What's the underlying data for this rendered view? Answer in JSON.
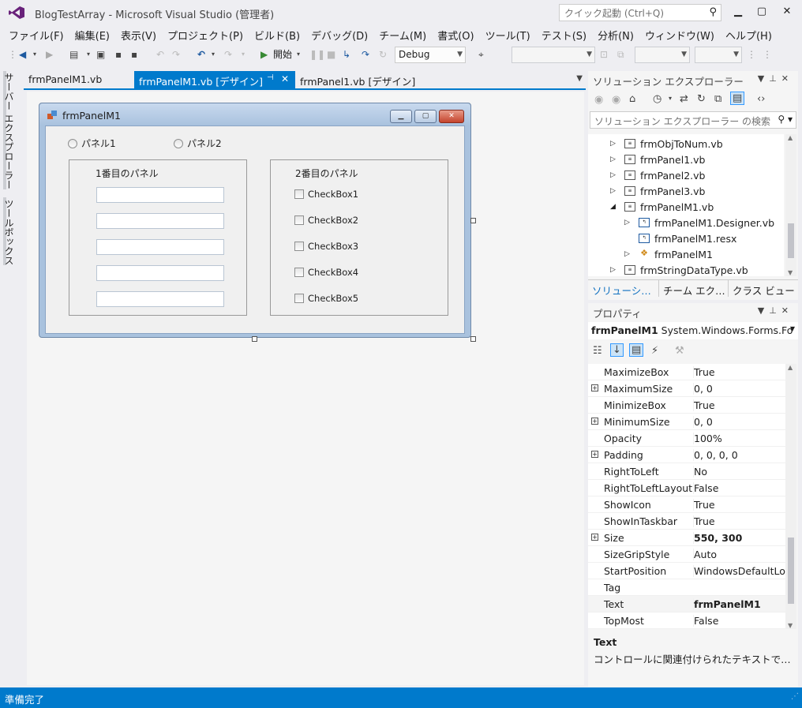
{
  "window": {
    "title": "BlogTestArray - Microsoft Visual Studio (管理者)",
    "quick_launch_placeholder": "クイック起動 (Ctrl+Q)"
  },
  "menu": [
    "ファイル(F)",
    "編集(E)",
    "表示(V)",
    "プロジェクト(P)",
    "ビルド(B)",
    "デバッグ(D)",
    "チーム(M)",
    "書式(O)",
    "ツール(T)",
    "テスト(S)",
    "分析(N)",
    "ウィンドウ(W)",
    "ヘルプ(H)"
  ],
  "toolbar": {
    "start_label": "開始",
    "config_value": "Debug"
  },
  "left_strip": {
    "server_explorer": "サーバー エクスプローラー",
    "toolbox": "ツールボックス"
  },
  "doc_tabs": [
    {
      "label": "frmPanelM1.vb",
      "active": false
    },
    {
      "label": "frmPanelM1.vb [デザイン]",
      "active": true
    },
    {
      "label": "frmPanel1.vb [デザイン]",
      "active": false
    }
  ],
  "form": {
    "title": "frmPanelM1",
    "radio1": "パネル1",
    "radio2": "パネル2",
    "group1_title": "1番目のパネル",
    "group2_title": "2番目のパネル",
    "checkboxes": [
      "CheckBox1",
      "CheckBox2",
      "CheckBox3",
      "CheckBox4",
      "CheckBox5"
    ]
  },
  "solution_explorer": {
    "header": "ソリューション エクスプローラー",
    "search_placeholder": "ソリューション エクスプローラー の検索",
    "tree": [
      {
        "label": "frmObjToNum.vb",
        "depth": 0,
        "arrow": "▷"
      },
      {
        "label": "frmPanel1.vb",
        "depth": 0,
        "arrow": "▷"
      },
      {
        "label": "frmPanel2.vb",
        "depth": 0,
        "arrow": "▷"
      },
      {
        "label": "frmPanel3.vb",
        "depth": 0,
        "arrow": "▷"
      },
      {
        "label": "frmPanelM1.vb",
        "depth": 0,
        "arrow": "◢"
      },
      {
        "label": "frmPanelM1.Designer.vb",
        "depth": 1,
        "arrow": "▷"
      },
      {
        "label": "frmPanelM1.resx",
        "depth": 1,
        "arrow": ""
      },
      {
        "label": "frmPanelM1",
        "depth": 1,
        "arrow": "▷"
      },
      {
        "label": "frmStringDataType.vb",
        "depth": 0,
        "arrow": "▷"
      }
    ],
    "bottom_tabs": [
      "ソリューシ…",
      "チーム エク…",
      "クラス ビュー"
    ]
  },
  "properties": {
    "header": "プロパティ",
    "object_name": "frmPanelM1",
    "object_type": "System.Windows.Forms.Fo",
    "rows": [
      {
        "name": "MaximizeBox",
        "value": "True",
        "expandable": false,
        "bold": false
      },
      {
        "name": "MaximumSize",
        "value": "0, 0",
        "expandable": true,
        "bold": false
      },
      {
        "name": "MinimizeBox",
        "value": "True",
        "expandable": false,
        "bold": false
      },
      {
        "name": "MinimumSize",
        "value": "0, 0",
        "expandable": true,
        "bold": false
      },
      {
        "name": "Opacity",
        "value": "100%",
        "expandable": false,
        "bold": false
      },
      {
        "name": "Padding",
        "value": "0, 0, 0, 0",
        "expandable": true,
        "bold": false
      },
      {
        "name": "RightToLeft",
        "value": "No",
        "expandable": false,
        "bold": false
      },
      {
        "name": "RightToLeftLayout",
        "value": "False",
        "expandable": false,
        "bold": false
      },
      {
        "name": "ShowIcon",
        "value": "True",
        "expandable": false,
        "bold": false
      },
      {
        "name": "ShowInTaskbar",
        "value": "True",
        "expandable": false,
        "bold": false
      },
      {
        "name": "Size",
        "value": "550, 300",
        "expandable": true,
        "bold": true
      },
      {
        "name": "SizeGripStyle",
        "value": "Auto",
        "expandable": false,
        "bold": false
      },
      {
        "name": "StartPosition",
        "value": "WindowsDefaultLoc",
        "expandable": false,
        "bold": false
      },
      {
        "name": "Tag",
        "value": "",
        "expandable": false,
        "bold": false
      },
      {
        "name": "Text",
        "value": "frmPanelM1",
        "expandable": false,
        "bold": true
      },
      {
        "name": "TopMost",
        "value": "False",
        "expandable": false,
        "bold": false
      }
    ],
    "desc_title": "Text",
    "desc_text": "コントロールに関連付けられたテキストで…"
  },
  "status": "準備完了",
  "colors": {
    "accent": "#007acc"
  }
}
